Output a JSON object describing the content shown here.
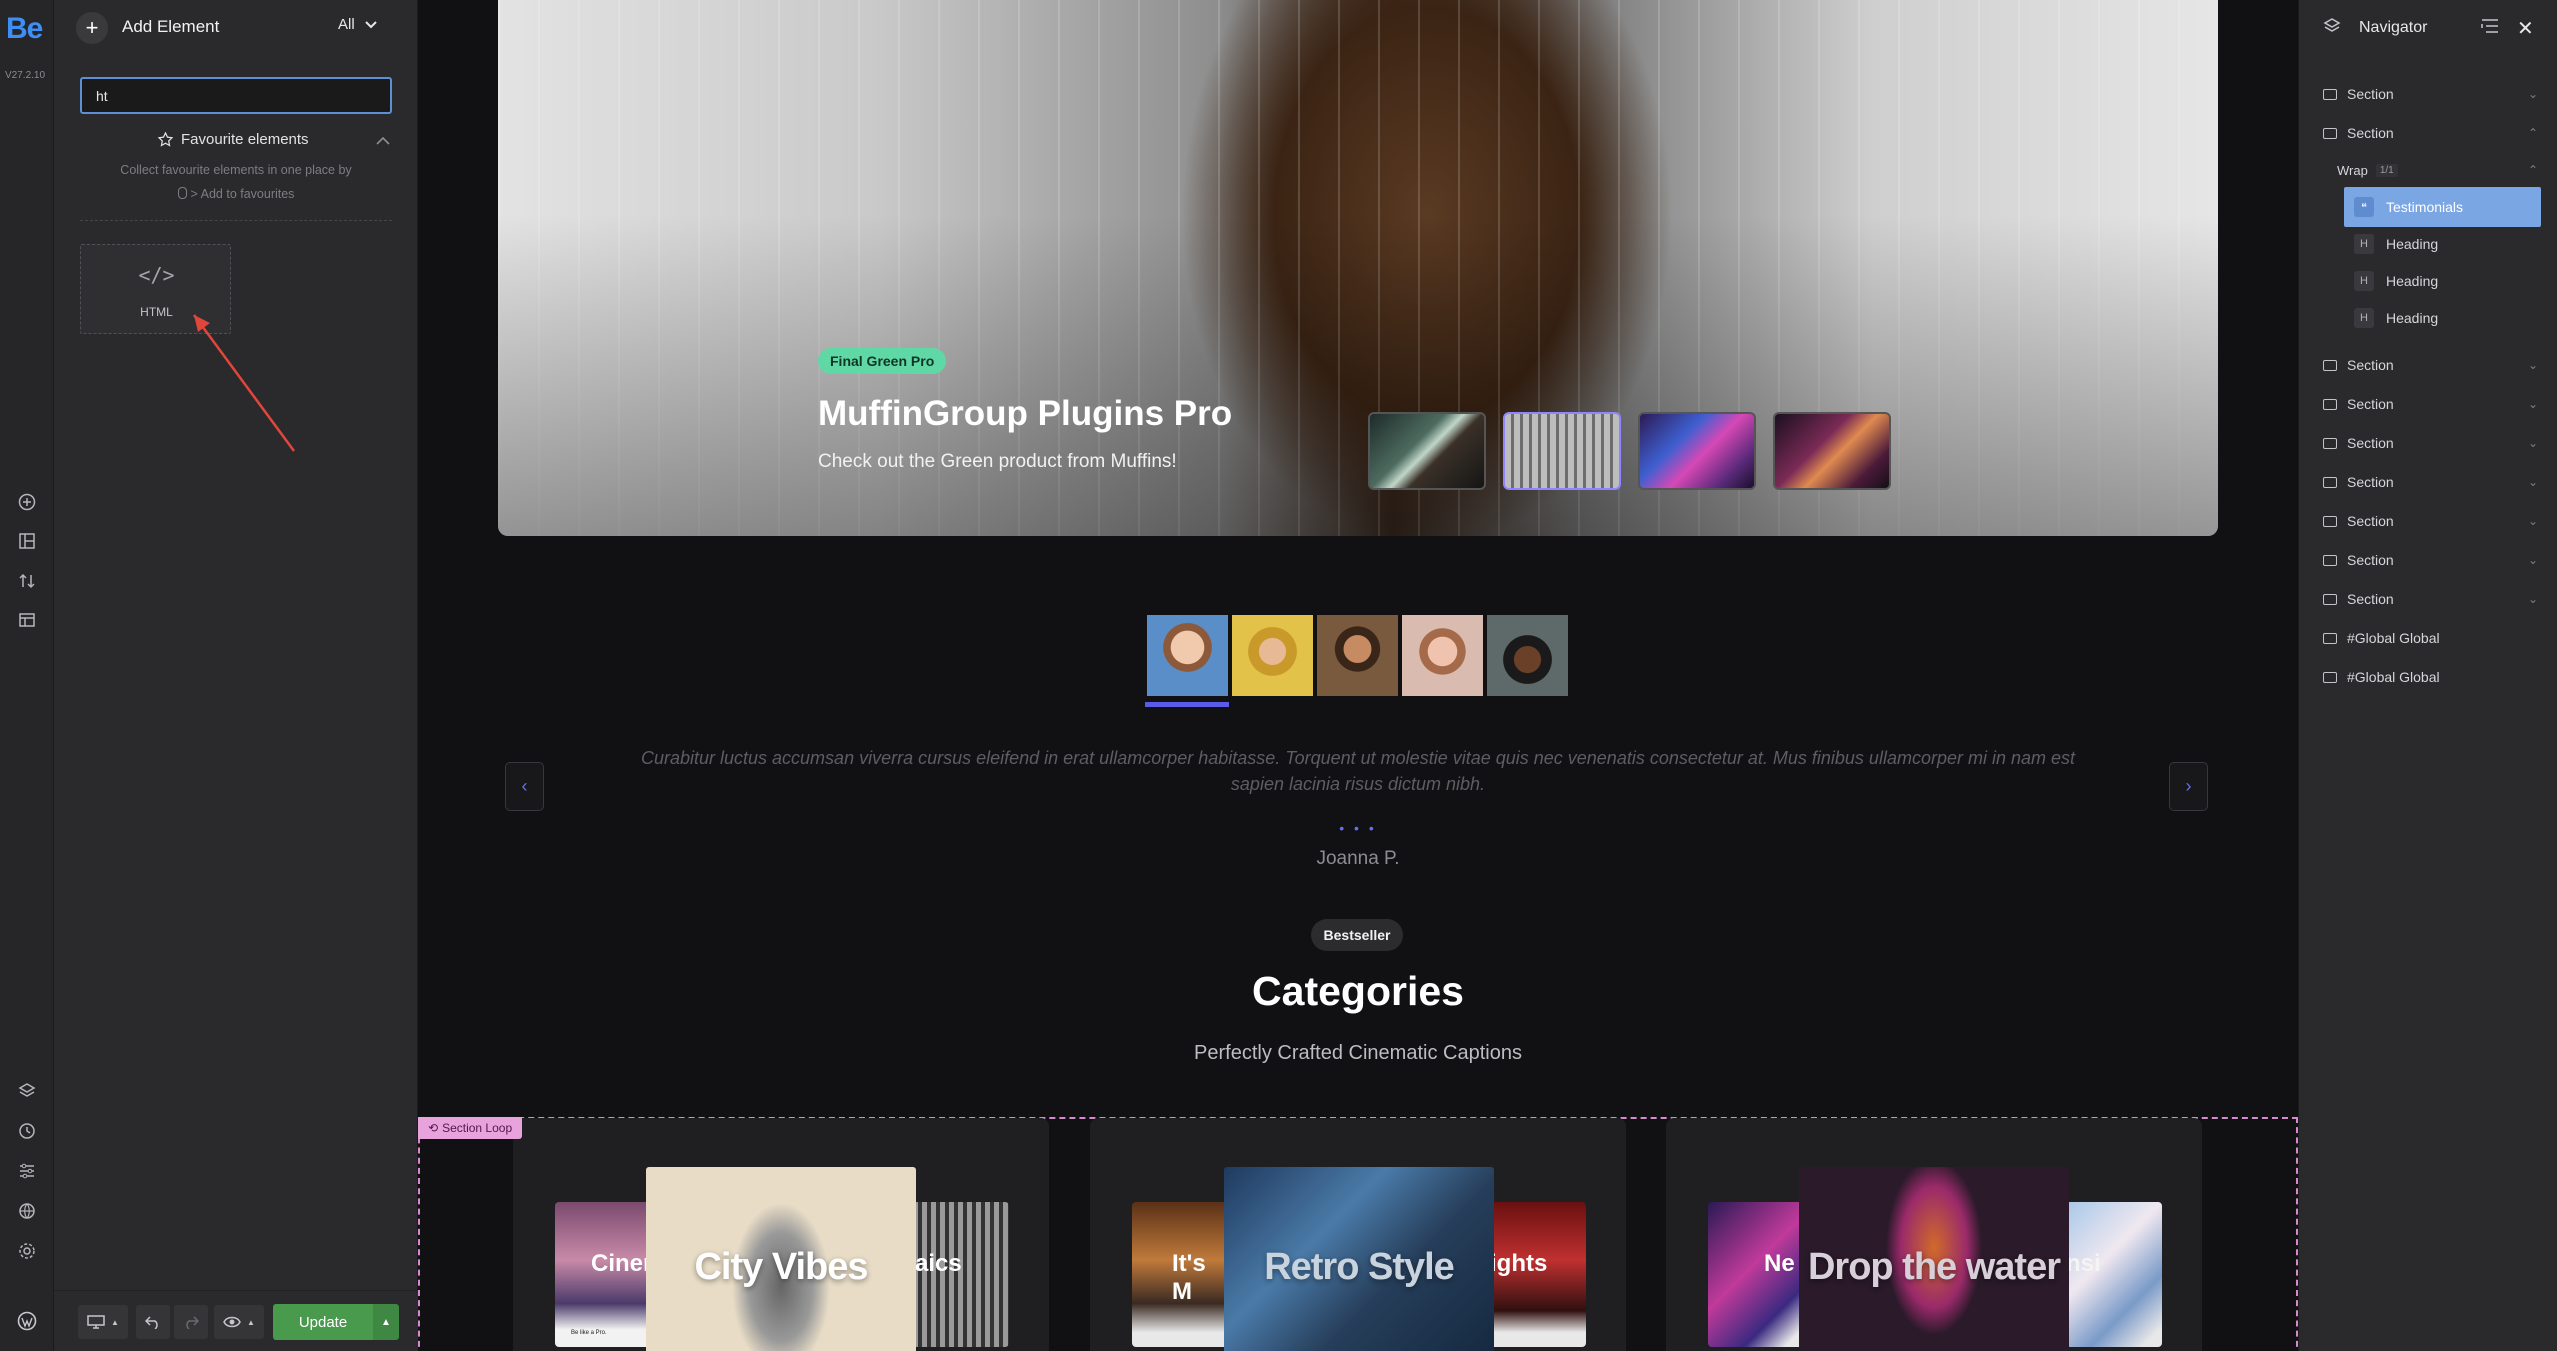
{
  "rail": {
    "logo": "Be",
    "version": "V27.2.10",
    "icons": [
      "add-circle-icon",
      "layout-icon",
      "sort-icon",
      "template-icon",
      "layers-icon",
      "history-icon",
      "sliders-icon",
      "globe-icon",
      "settings-icon",
      "wordpress-icon"
    ]
  },
  "panel": {
    "title": "Add Element",
    "filter": "All",
    "search_value": "ht",
    "favourites_label": "Favourite elements",
    "favourites_hint_line1": "Collect favourite elements in one place by",
    "favourites_hint_line2": "> Add to favourites",
    "element_html_label": "HTML",
    "element_html_glyph": "</>"
  },
  "toolbar": {
    "update_label": "Update"
  },
  "hero": {
    "tag": "Final Green Pro",
    "title": "MuffinGroup Plugins Pro",
    "subtitle": "Check out the Green product from Muffins!"
  },
  "testimonials": {
    "quote": "Curabitur luctus accumsan viverra cursus eleifend in erat ullamcorper habitasse. Torquent ut molestie vitae quis nec venenatis consectetur at. Mus finibus ullamcorper mi in nam est sapien lacinia risus dictum nibh.",
    "dots": "• • •",
    "author": "Joanna P."
  },
  "categories": {
    "badge": "Bestseller",
    "title": "Categories",
    "subtitle": "Perfectly Crafted Cinematic Captions",
    "loop_tag": "Section Loop",
    "cards": [
      {
        "main": "City Vibes",
        "left_word": "Ciner",
        "right_word": "aics"
      },
      {
        "main": "Retro Style",
        "left_word": "It's M",
        "right_word": "ights"
      },
      {
        "main": "Drop the water",
        "left_word": "Ne",
        "right_word": "nsi"
      }
    ],
    "card_footer": "Be like a Pro."
  },
  "navigator": {
    "title": "Navigator",
    "rows": [
      {
        "label": "Section",
        "open": false
      },
      {
        "label": "Section",
        "open": true
      },
      {
        "label": "Wrap",
        "badge": "1/1"
      },
      {
        "label": "Testimonials",
        "selected": true
      },
      {
        "label": "Heading"
      },
      {
        "label": "Heading"
      },
      {
        "label": "Heading"
      },
      {
        "label": "Section"
      },
      {
        "label": "Section"
      },
      {
        "label": "Section"
      },
      {
        "label": "Section"
      },
      {
        "label": "Section"
      },
      {
        "label": "Section"
      },
      {
        "label": "Section"
      },
      {
        "label": "#Global Global"
      },
      {
        "label": "#Global Global"
      }
    ]
  },
  "colors": {
    "accent": "#5b5bea",
    "update": "#4a9a4e",
    "selected": "#6e9fe0",
    "loop": "#e8a2dc"
  }
}
